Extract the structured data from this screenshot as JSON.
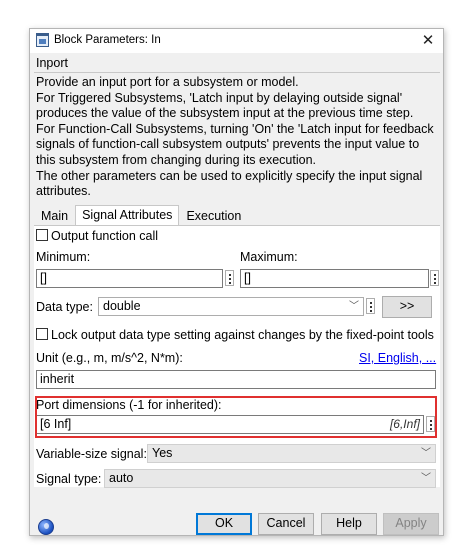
{
  "window": {
    "title": "Block Parameters: In"
  },
  "group": {
    "label": "Inport"
  },
  "description": "Provide an input port for a subsystem or model.\nFor Triggered Subsystems, 'Latch input by delaying outside signal' produces the value of the subsystem input at the previous time step.\nFor Function-Call Subsystems, turning 'On' the 'Latch input for feedback signals of function-call subsystem outputs' prevents the input value to this subsystem from changing during its execution.\nThe other parameters can be used to explicitly specify the input signal attributes.",
  "tabs": [
    {
      "label": "Main",
      "active": false
    },
    {
      "label": "Signal Attributes",
      "active": true
    },
    {
      "label": "Execution",
      "active": false
    }
  ],
  "signal_attributes": {
    "output_function_call_label": "Output function call",
    "output_function_call_checked": false,
    "minimum_label": "Minimum:",
    "minimum_value": "[]",
    "maximum_label": "Maximum:",
    "maximum_value": "[]",
    "data_type_label": "Data type:",
    "data_type_value": "double",
    "data_type_assistant_button": ">>",
    "lock_output_label": "Lock output data type setting against changes by the fixed-point tools",
    "lock_output_checked": false,
    "unit_label": "Unit (e.g., m, m/s^2, N*m):",
    "unit_link": "SI, English, ...",
    "unit_value": "inherit",
    "port_dimensions_label": "Port dimensions (-1 for inherited):",
    "port_dimensions_value": "[6 Inf]",
    "port_dimensions_hint": "[6,Inf]",
    "variable_size_label": "Variable-size signal:",
    "variable_size_value": "Yes",
    "signal_type_label": "Signal type:",
    "signal_type_value": "auto"
  },
  "buttons": {
    "ok": "OK",
    "cancel": "Cancel",
    "help": "Help",
    "apply": "Apply"
  },
  "colors": {
    "highlight": "#e0302f",
    "ok_border": "#0078d7",
    "link": "#0000ee"
  }
}
